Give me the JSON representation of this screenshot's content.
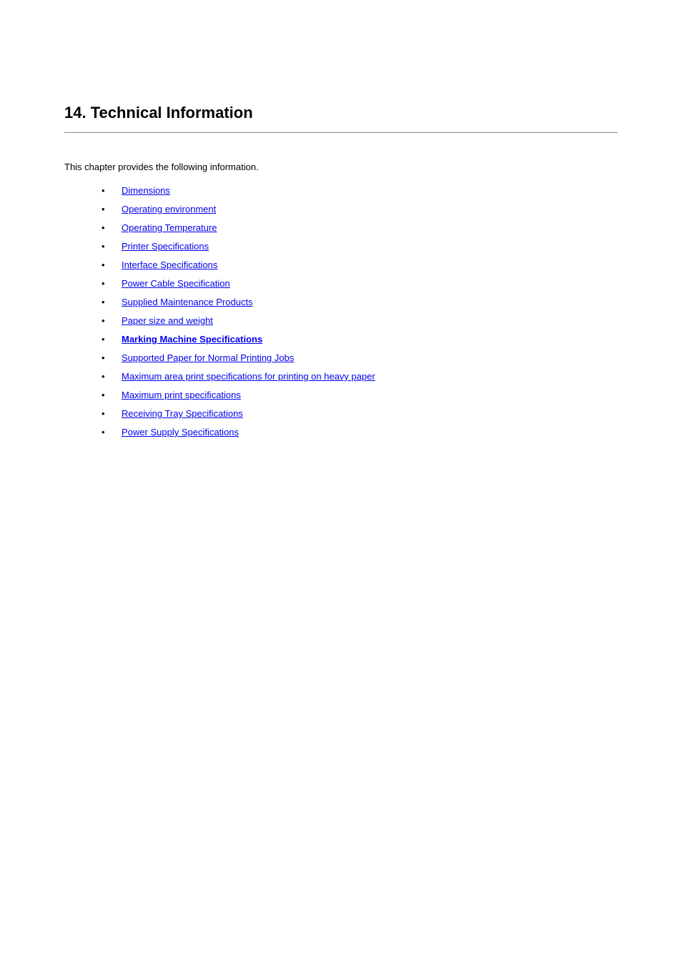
{
  "title": "14. Technical Information",
  "intro": "This chapter provides the following information.",
  "links": [
    {
      "label": "Dimensions",
      "current": false
    },
    {
      "label": "Operating environment",
      "current": false
    },
    {
      "label": "Operating Temperature",
      "current": false
    },
    {
      "label": "Printer Specifications",
      "current": false
    },
    {
      "label": "Interface Specifications",
      "current": false
    },
    {
      "label": "Power Cable Specification",
      "current": false
    },
    {
      "label": "Supplied Maintenance Products",
      "current": false
    },
    {
      "label": "Paper size and weight",
      "current": false
    },
    {
      "label": "Marking Machine Specifications",
      "current": true
    },
    {
      "label": "Supported Paper for Normal Printing Jobs",
      "current": false
    },
    {
      "label": "Maximum area print specifications for printing on heavy paper",
      "current": false
    },
    {
      "label": "Maximum print specifications",
      "current": false
    },
    {
      "label": "Receiving Tray Specifications",
      "current": false
    },
    {
      "label": "Power Supply Specifications",
      "current": false
    }
  ]
}
